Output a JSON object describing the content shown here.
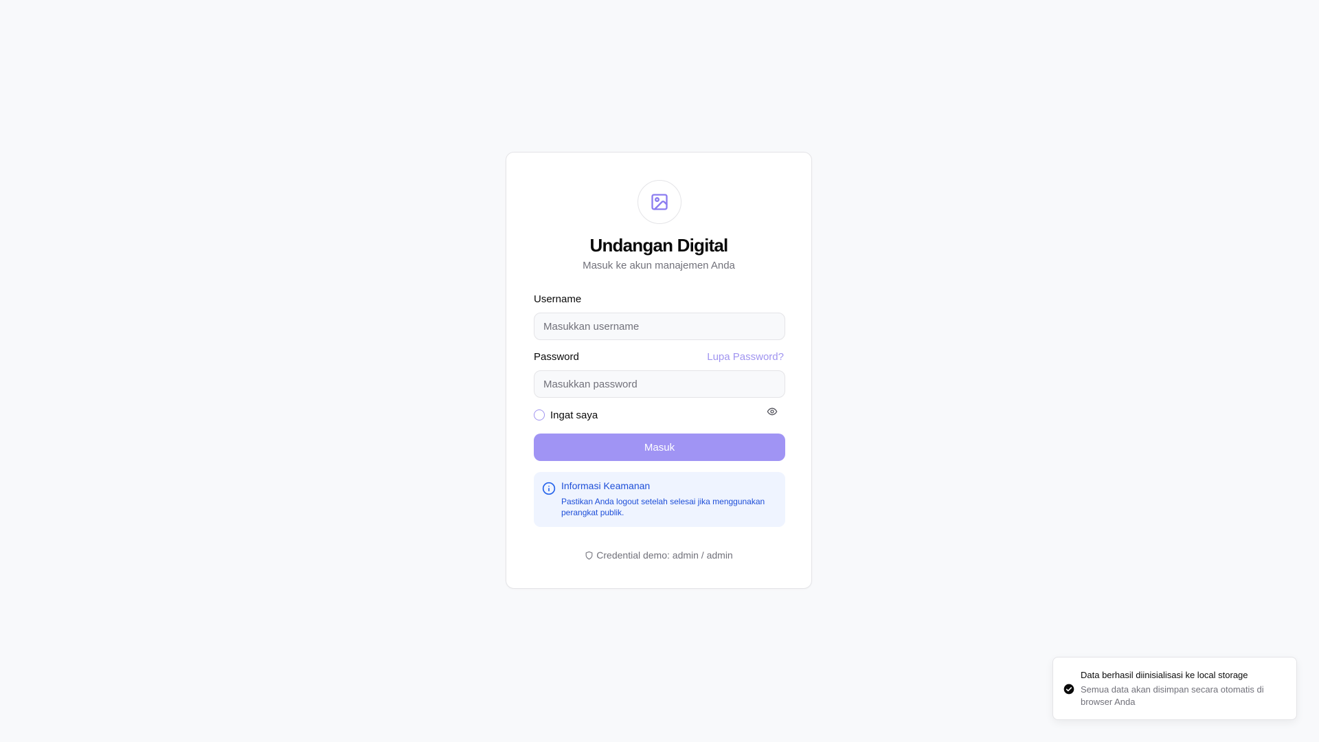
{
  "app": {
    "title": "Undangan Digital",
    "subtitle": "Masuk ke akun manajemen Anda",
    "logo_icon": "image-icon"
  },
  "form": {
    "username_label": "Username",
    "username_placeholder": "Masukkan username",
    "username_value": "",
    "password_label": "Password",
    "forgot_link": "Lupa Password?",
    "password_placeholder": "Masukkan password",
    "password_value": "",
    "password_toggle_icon": "eye-icon",
    "remember_label": "Ingat saya",
    "remember_checked": false,
    "submit_label": "Masuk"
  },
  "security_info": {
    "icon": "info-icon",
    "title": "Informasi Keamanan",
    "text": "Pastikan Anda logout setelah selesai jika menggunakan perangkat publik."
  },
  "demo_credential": {
    "icon": "shield-icon",
    "text": "Credential demo: admin / admin"
  },
  "toast": {
    "icon": "check-circle-icon",
    "title": "Data berhasil diinisialisasi ke local storage",
    "description": "Semua data akan disimpan secara otomatis di browser Anda"
  },
  "colors": {
    "background": "#f8f9fb",
    "accent": "#a094f4",
    "info_background": "#eff4ff",
    "info_text": "#1d4ed8",
    "muted_text": "#71717a"
  }
}
